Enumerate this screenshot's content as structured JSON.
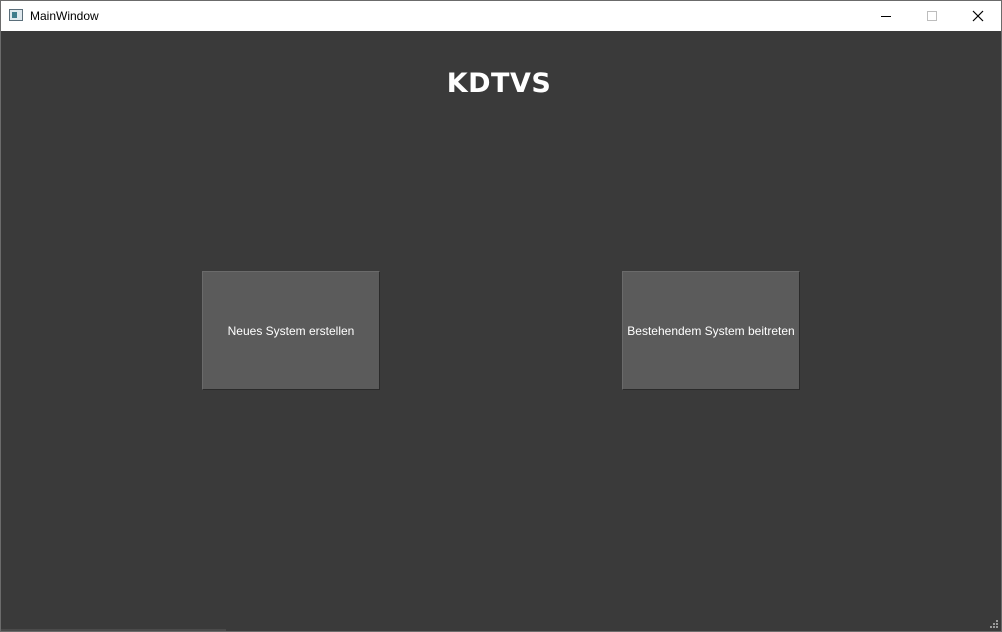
{
  "window": {
    "title": "MainWindow",
    "icons": {
      "app": "app-window-icon",
      "minimize": "minimize-icon",
      "maximize": "maximize-icon",
      "close": "close-icon"
    }
  },
  "main": {
    "heading": "KDTVS",
    "buttons": {
      "new_system": "Neues System erstellen",
      "join_system": "Bestehendem System beitreten"
    }
  },
  "colors": {
    "background": "#3a3a3a",
    "button": "#5b5b5b",
    "text": "#ffffff"
  }
}
